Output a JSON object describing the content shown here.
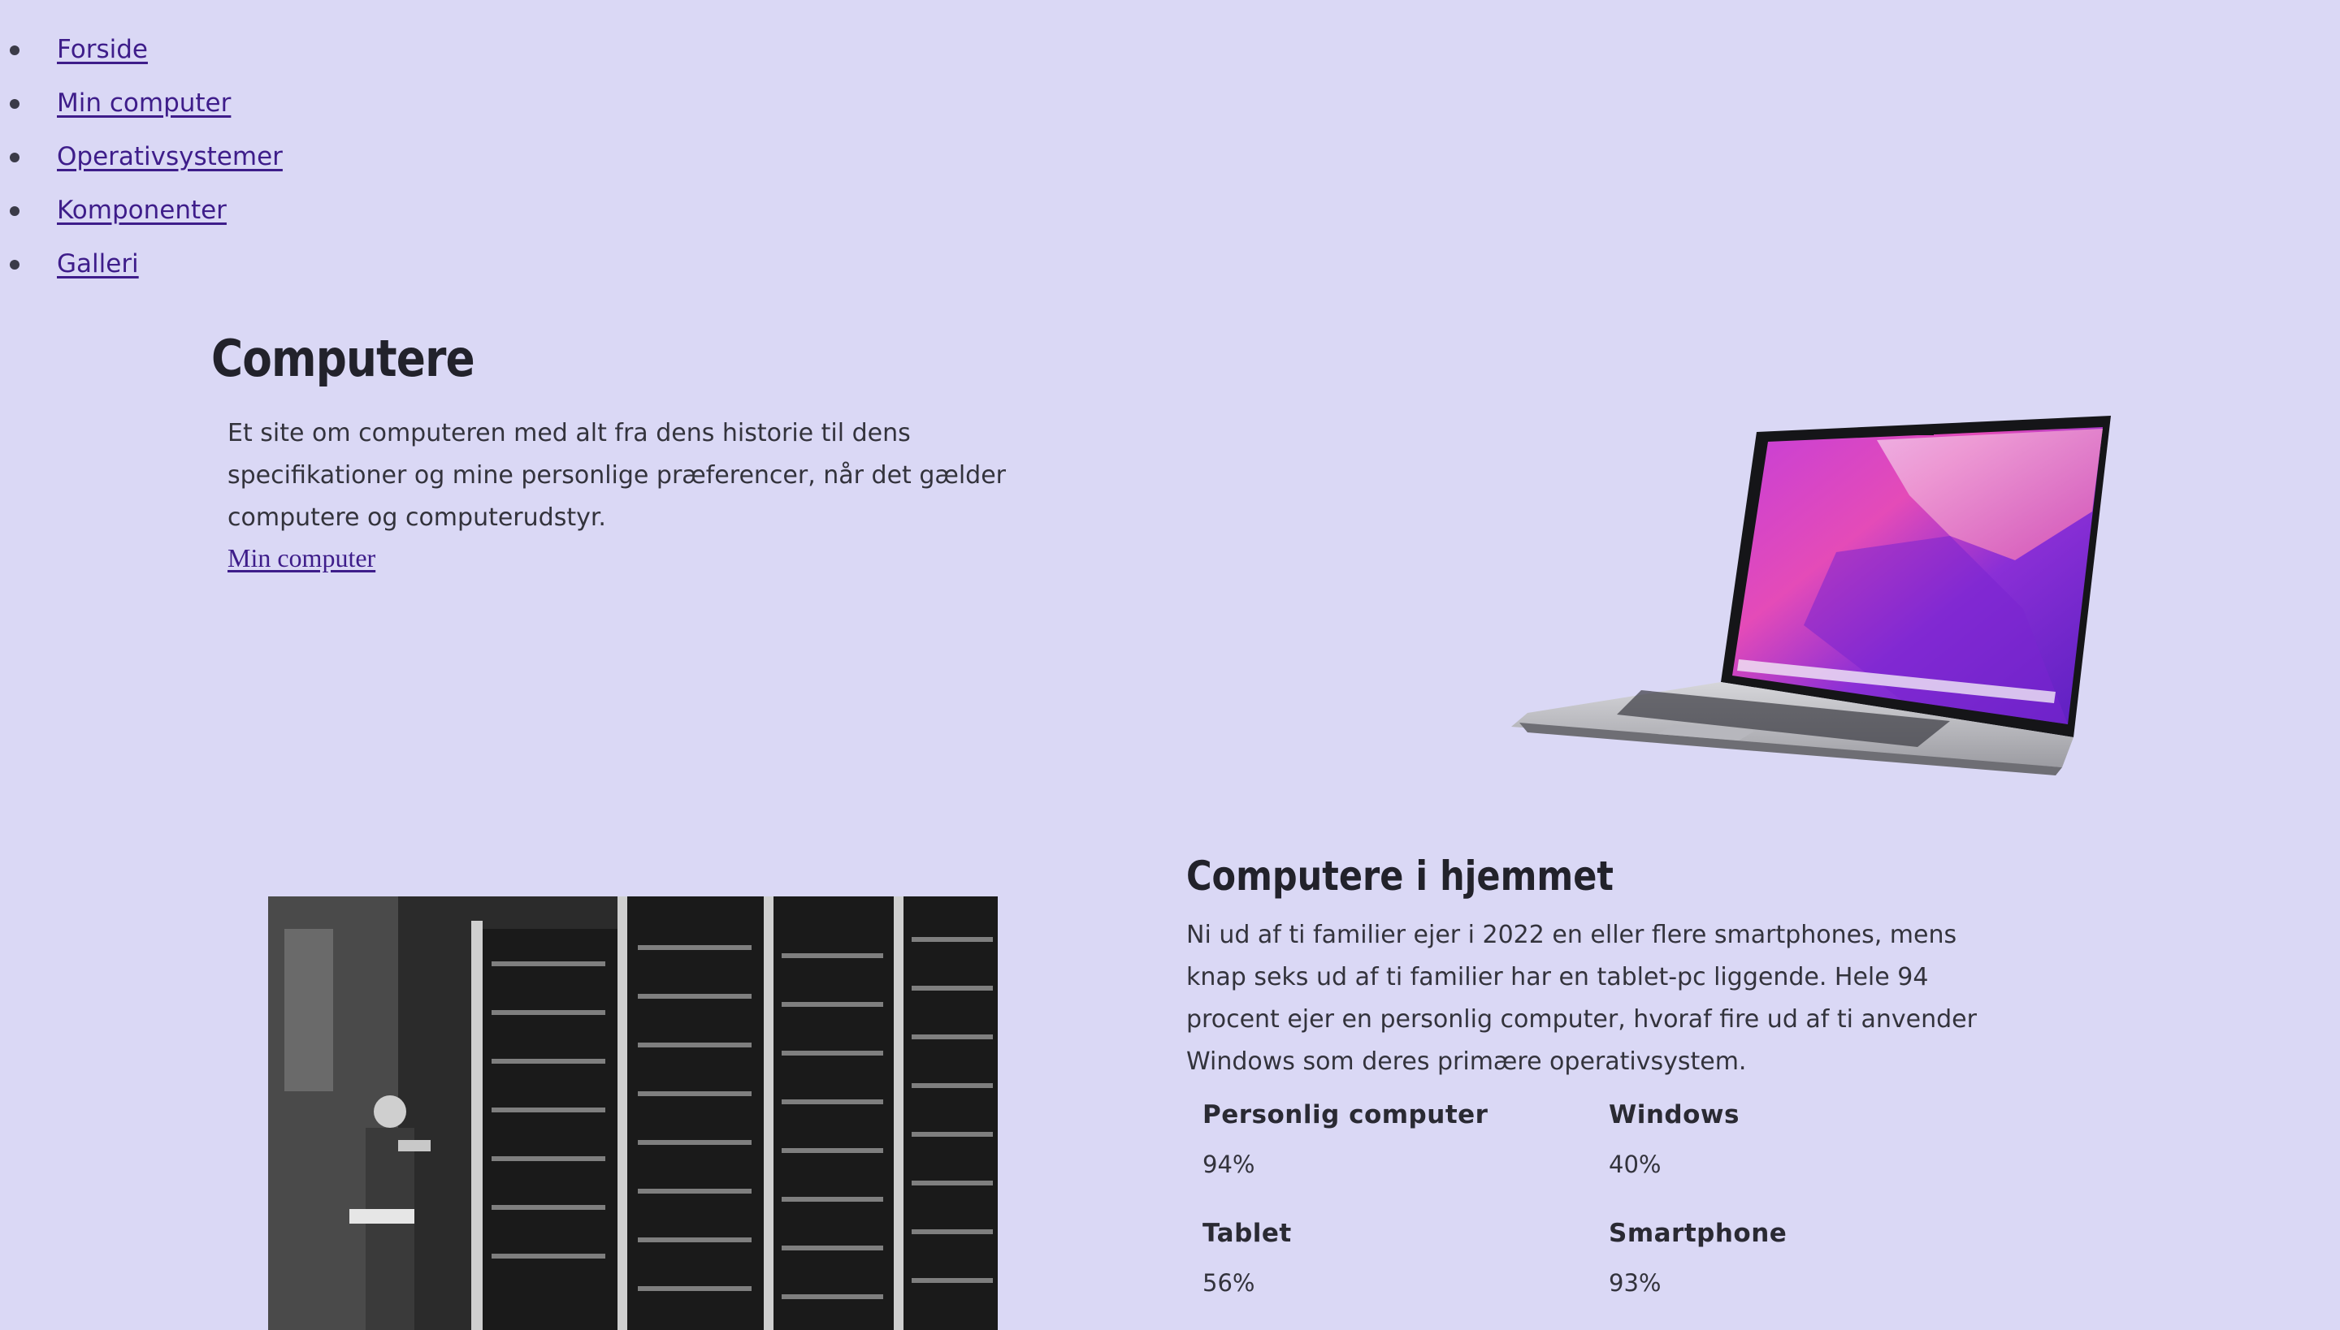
{
  "nav": {
    "items": [
      {
        "label": "Forside"
      },
      {
        "label": "Min computer"
      },
      {
        "label": "Operativsystemer"
      },
      {
        "label": "Komponenter"
      },
      {
        "label": "Galleri"
      }
    ]
  },
  "hero": {
    "title": "Computere",
    "text": "Et site om computeren med alt fra dens historie til dens specifikationer og mine personlige præferencer, når det gælder computere og computerudstyr.",
    "link": "Min computer"
  },
  "home": {
    "title": "Computere i hjemmet",
    "text": "Ni ud af ti familier ejer i 2022 en eller flere smartphones, mens knap seks ud af ti familier har en tablet-pc liggende. Hele 94 procent ejer en personlig computer, hvoraf fire ud af ti anvender Windows som deres primære operativsystem.",
    "stats": [
      {
        "label": "Personlig computer",
        "value": "94%"
      },
      {
        "label": "Windows",
        "value": "40%"
      },
      {
        "label": "Tablet",
        "value": "56%"
      },
      {
        "label": "Smartphone",
        "value": "93%"
      }
    ]
  },
  "colors": {
    "background": "#dad8f5",
    "link": "#3e1d8a",
    "text": "#33333c"
  }
}
